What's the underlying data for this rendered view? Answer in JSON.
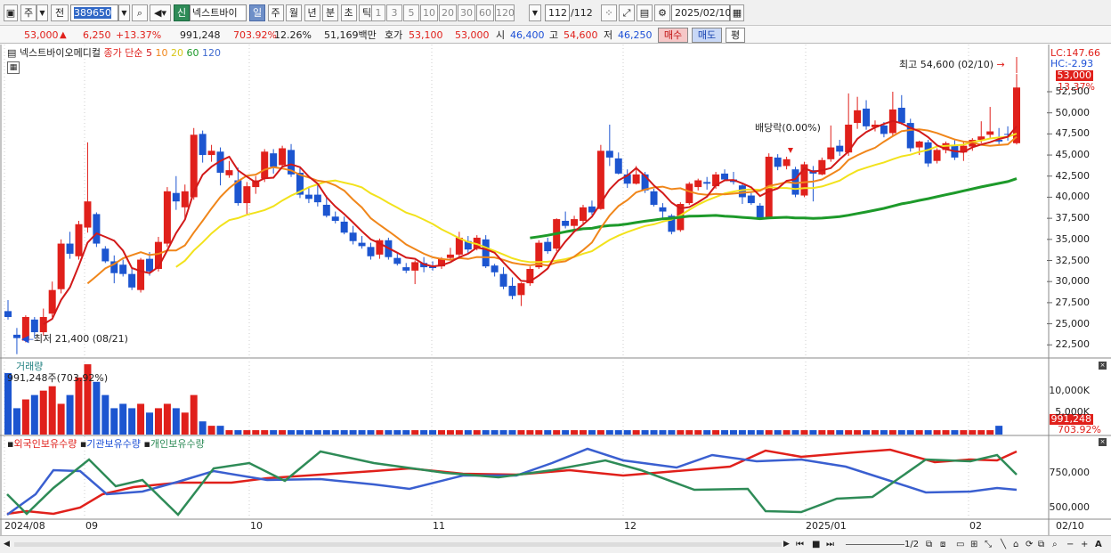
{
  "toolbar": {
    "type_label": "주",
    "prev_label": "전",
    "code": "389650",
    "new_badge": "신",
    "stock_name": "넥스트바이",
    "periods": [
      "일",
      "주",
      "월",
      "년",
      "분",
      "초",
      "틱"
    ],
    "active_period": "일",
    "intervals": [
      "1",
      "3",
      "5",
      "10",
      "20",
      "30",
      "60",
      "120"
    ],
    "count": "112",
    "count_total": "/112",
    "date": "2025/02/10"
  },
  "quote": {
    "price": "53,000",
    "up_arrow": "▲",
    "change": "6,250",
    "change_pct": "+13.37%",
    "volume": "991,248",
    "volume_pct": "703.92%",
    "turnover": "12.26%",
    "amount": "51,169백만",
    "bid_label": "호가",
    "bid": "53,100",
    "ask": "53,000",
    "open_label": "시",
    "open": "46,400",
    "high_label": "고",
    "high": "54,600",
    "low_label": "저",
    "low": "46,250",
    "buy_label": "매수",
    "sell_label": "매도",
    "eval_label": "평"
  },
  "colors": {
    "up": "#e0201b",
    "down": "#1c55d0",
    "ma5": "#d21919",
    "ma10": "#f0861a",
    "ma20": "#f2e21c",
    "ma60": "#1d9a2a",
    "ma120": "#3f6bd0"
  },
  "legend": {
    "name": "넥스트바이오메디컬",
    "price_type": "종가 단순",
    "ma": [
      "5",
      "10",
      "20",
      "60",
      "120"
    ]
  },
  "annotations": {
    "high": "최고 54,600 (02/10)",
    "low": "최저 21,400 (08/21)",
    "dividend": "배당락(0.00%)",
    "lc": "LC:147.66",
    "hc": "HC:-2.93",
    "last_price": "53,000",
    "last_pct": "13.37%"
  },
  "volume_panel": {
    "title": "거래량",
    "value": "991,248주(703.92%)",
    "last": "991,248",
    "last_pct": "703.92%"
  },
  "holding_panel": {
    "foreign": "외국인보유수량",
    "inst": "기관보유수량",
    "indiv": "개인보유수량"
  },
  "status": {
    "pages": "1/2"
  },
  "chart_data": {
    "type": "candlestick",
    "x_labels": [
      "2024/08",
      "09",
      "10",
      "11",
      "12",
      "2025/01",
      "02",
      "02/10"
    ],
    "price_axis": {
      "ticks": [
        "52,500",
        "50,000",
        "47,500",
        "45,000",
        "42,500",
        "40,000",
        "37,500",
        "35,000",
        "32,500",
        "30,000",
        "27,500",
        "25,000",
        "22,500"
      ],
      "ylim": [
        20000,
        56000
      ]
    },
    "volume_axis": {
      "ticks": [
        "10,000K",
        "5,000K"
      ]
    },
    "holding_axis": {
      "ticks": [
        "750,000",
        "500,000"
      ]
    },
    "candles": [
      [
        26500,
        27800,
        25500,
        25800
      ],
      [
        23700,
        24500,
        21400,
        23300
      ],
      [
        23000,
        26000,
        22800,
        25800
      ],
      [
        25500,
        25800,
        23300,
        24000
      ],
      [
        24000,
        26800,
        23600,
        25800
      ],
      [
        26200,
        30000,
        25800,
        29000
      ],
      [
        29100,
        35000,
        28600,
        34500
      ],
      [
        34500,
        35900,
        32700,
        33300
      ],
      [
        33000,
        37200,
        32600,
        36800
      ],
      [
        36400,
        46500,
        35800,
        39500
      ],
      [
        38000,
        38200,
        34100,
        34500
      ],
      [
        33900,
        34200,
        32200,
        32400
      ],
      [
        32400,
        33100,
        29800,
        31000
      ],
      [
        32000,
        32600,
        30600,
        30900
      ],
      [
        30900,
        31500,
        29000,
        29300
      ],
      [
        29000,
        32800,
        28700,
        32600
      ],
      [
        32700,
        33500,
        30700,
        31200
      ],
      [
        31500,
        35300,
        31200,
        34700
      ],
      [
        34500,
        41200,
        34100,
        40700
      ],
      [
        40500,
        42500,
        38500,
        39500
      ],
      [
        38800,
        41500,
        37500,
        40700
      ],
      [
        40000,
        48200,
        39700,
        47400
      ],
      [
        47500,
        47900,
        44100,
        45000
      ],
      [
        45000,
        46200,
        44200,
        45500
      ],
      [
        45400,
        45900,
        41400,
        42900
      ],
      [
        42600,
        44300,
        42300,
        43200
      ],
      [
        42000,
        43500,
        39000,
        39300
      ],
      [
        39300,
        41800,
        37900,
        41300
      ],
      [
        41200,
        42500,
        40400,
        42000
      ],
      [
        42200,
        45700,
        41800,
        45400
      ],
      [
        45200,
        45700,
        42800,
        43600
      ],
      [
        43800,
        46100,
        43600,
        45800
      ],
      [
        45600,
        46300,
        42400,
        42700
      ],
      [
        42900,
        43600,
        39900,
        40300
      ],
      [
        40300,
        41200,
        39300,
        39800
      ],
      [
        40300,
        41500,
        38900,
        39400
      ],
      [
        39100,
        40200,
        37600,
        37800
      ],
      [
        37700,
        38300,
        36900,
        37200
      ],
      [
        37100,
        37700,
        35600,
        35800
      ],
      [
        35800,
        36600,
        34400,
        34800
      ],
      [
        34600,
        35400,
        33900,
        34200
      ],
      [
        34100,
        34600,
        32600,
        33000
      ],
      [
        33200,
        35100,
        32700,
        34900
      ],
      [
        34900,
        35200,
        32600,
        32900
      ],
      [
        32800,
        33400,
        31900,
        32100
      ],
      [
        31700,
        32200,
        31000,
        31300
      ],
      [
        31300,
        32500,
        29700,
        32300
      ],
      [
        32200,
        32900,
        31100,
        31700
      ],
      [
        31800,
        32400,
        31300,
        31600
      ],
      [
        31800,
        32900,
        31500,
        32700
      ],
      [
        32800,
        34000,
        32500,
        33200
      ],
      [
        33200,
        35900,
        32900,
        35200
      ],
      [
        34800,
        35400,
        33400,
        33800
      ],
      [
        33900,
        35500,
        33700,
        35200
      ],
      [
        35000,
        35500,
        31600,
        31800
      ],
      [
        31900,
        32100,
        30600,
        31100
      ],
      [
        30900,
        31700,
        29100,
        29400
      ],
      [
        29500,
        30500,
        27900,
        28300
      ],
      [
        28400,
        29900,
        27100,
        29800
      ],
      [
        29800,
        31800,
        29500,
        31500
      ],
      [
        31700,
        34900,
        31500,
        34600
      ],
      [
        34700,
        35200,
        33300,
        33600
      ],
      [
        33900,
        37500,
        33600,
        37400
      ],
      [
        37200,
        38300,
        36300,
        36600
      ],
      [
        36600,
        37800,
        36100,
        37400
      ],
      [
        37200,
        39100,
        36800,
        38800
      ],
      [
        38900,
        39600,
        37900,
        38200
      ],
      [
        38600,
        46200,
        38500,
        45500
      ],
      [
        45500,
        48600,
        43700,
        44700
      ],
      [
        44600,
        45300,
        42700,
        42800
      ],
      [
        42700,
        43300,
        41100,
        41600
      ],
      [
        41600,
        43700,
        41500,
        42700
      ],
      [
        42700,
        43000,
        40500,
        40800
      ],
      [
        40700,
        41000,
        38900,
        39100
      ],
      [
        38800,
        39300,
        37500,
        38300
      ],
      [
        37800,
        38000,
        35600,
        35900
      ],
      [
        36100,
        39400,
        35900,
        39200
      ],
      [
        39300,
        41800,
        39100,
        41600
      ],
      [
        41200,
        42200,
        40800,
        42000
      ],
      [
        41800,
        42400,
        40900,
        41600
      ],
      [
        41300,
        43000,
        41000,
        42700
      ],
      [
        42800,
        43300,
        42000,
        42100
      ],
      [
        42100,
        43000,
        41500,
        41800
      ],
      [
        41400,
        41700,
        39200,
        40000
      ],
      [
        40200,
        40500,
        39100,
        39300
      ],
      [
        39000,
        39300,
        37300,
        37500
      ],
      [
        37600,
        45200,
        37400,
        44800
      ],
      [
        44700,
        45100,
        43200,
        43600
      ],
      [
        43700,
        44800,
        43300,
        44500
      ],
      [
        43300,
        43600,
        40000,
        40300
      ],
      [
        40200,
        44200,
        40000,
        43900
      ],
      [
        43200,
        43700,
        39500,
        42800
      ],
      [
        42700,
        44700,
        42600,
        44400
      ],
      [
        44500,
        48500,
        44200,
        45900
      ],
      [
        46100,
        46800,
        44900,
        45400
      ],
      [
        45300,
        52300,
        44900,
        48600
      ],
      [
        48800,
        51900,
        48100,
        50300
      ],
      [
        50500,
        51500,
        48000,
        48400
      ],
      [
        48300,
        49100,
        47800,
        48600
      ],
      [
        48500,
        48900,
        47100,
        47500
      ],
      [
        47600,
        52500,
        47300,
        50400
      ],
      [
        50600,
        52100,
        48600,
        48800
      ],
      [
        48800,
        49300,
        45400,
        45800
      ],
      [
        45900,
        46700,
        45000,
        46600
      ],
      [
        46500,
        46800,
        43600,
        44000
      ],
      [
        44300,
        45800,
        44000,
        45600
      ],
      [
        45600,
        46600,
        45200,
        46400
      ],
      [
        46200,
        46900,
        44400,
        44700
      ],
      [
        45300,
        46700,
        44300,
        46100
      ],
      [
        46000,
        47000,
        45500,
        46800
      ],
      [
        46800,
        49000,
        46400,
        47200
      ],
      [
        47400,
        50700,
        46900,
        47800
      ],
      [
        46800,
        48200,
        46300,
        46600
      ],
      [
        47500,
        48400,
        46700,
        47400
      ],
      [
        46400,
        54600,
        46250,
        53000
      ]
    ],
    "volume": [
      14,
      6,
      8,
      9,
      10,
      11,
      7,
      9,
      13,
      16,
      12,
      9,
      6,
      7,
      6,
      7,
      5,
      6,
      7,
      6,
      5,
      9,
      3,
      2,
      2,
      1,
      1,
      1,
      1,
      1,
      1,
      1,
      1,
      1,
      1,
      1,
      1,
      1,
      1,
      1,
      1,
      1,
      1,
      1,
      1,
      1,
      1,
      1,
      1,
      1,
      1,
      1,
      1,
      1,
      1,
      1,
      1,
      1,
      1,
      1,
      1,
      1,
      1,
      1,
      1,
      1,
      1,
      1,
      1,
      1,
      1,
      1,
      1,
      1,
      1,
      1,
      1,
      1,
      1,
      1,
      1,
      1,
      1,
      1,
      1,
      1,
      1,
      1,
      1,
      1,
      1,
      1,
      1,
      1,
      1,
      1,
      1,
      1,
      1,
      1,
      1,
      1,
      1,
      1,
      1,
      1,
      1,
      1,
      1,
      1,
      1,
      1,
      2
    ]
  }
}
